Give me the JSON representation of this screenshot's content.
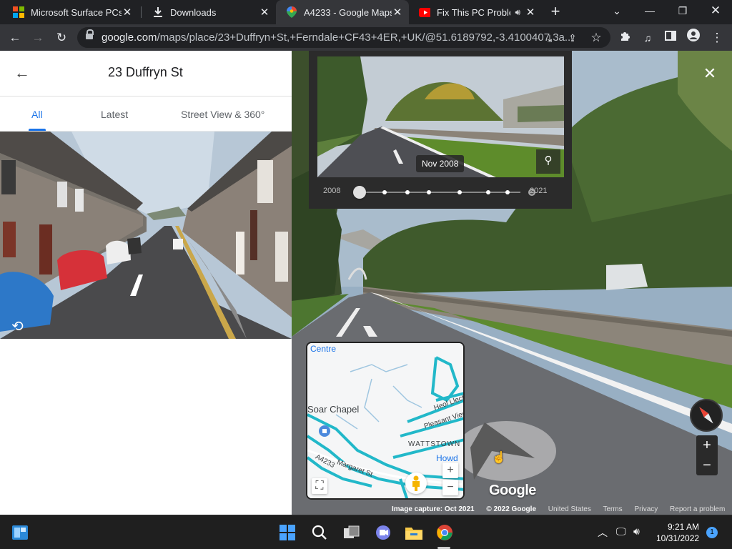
{
  "browser": {
    "tabs": [
      {
        "title": "Microsoft Surface PCs,",
        "icon": "microsoft-icon",
        "active": false
      },
      {
        "title": "Downloads",
        "icon": "download-icon",
        "active": false
      },
      {
        "title": "A4233 - Google Maps",
        "icon": "maps-pin-icon",
        "active": true
      },
      {
        "title": "Fix This PC Problem",
        "icon": "youtube-icon",
        "active": false
      }
    ],
    "url_host": "google.com",
    "url_path": "/maps/place/23+Duffryn+St,+Ferndale+CF43+4ER,+UK/@51.6189792,-3.4100407,3a...",
    "window_controls": [
      "chevron-down",
      "minimize",
      "maximize",
      "close"
    ]
  },
  "place_panel": {
    "title": "23 Duffryn St",
    "tabs": [
      "All",
      "Latest",
      "Street View & 360°"
    ],
    "active_tab": "All"
  },
  "timeline": {
    "date": "Nov 2008",
    "start_year": "2008",
    "end_year": "2021",
    "selected_fraction": 0
  },
  "minimap": {
    "labels": {
      "centre": "Centre",
      "soar_chapel": "Soar Chapel",
      "heol": "Heol Llech",
      "pleasant": "Pleasant View",
      "wattstown": "WATTSTOWN",
      "howd": "Howd",
      "a4233": "A4233",
      "margaret": "Margaret St"
    }
  },
  "streetview": {
    "logo": "Google",
    "footer": {
      "capture": "Image capture: Oct 2021",
      "copyright": "© 2022 Google",
      "country": "United States",
      "terms": "Terms",
      "privacy": "Privacy",
      "report": "Report a problem"
    }
  },
  "taskbar": {
    "time": "9:21 AM",
    "date": "10/31/2022",
    "notifications": "1"
  },
  "colors": {
    "accent_blue": "#1a73e8",
    "map_road_cyan": "#22b8c9",
    "chrome_dark": "#202124"
  }
}
